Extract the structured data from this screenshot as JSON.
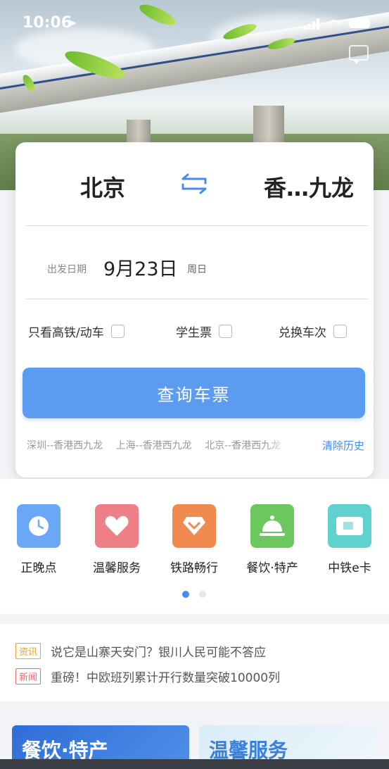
{
  "status_bar": {
    "time": "10:06",
    "location_icon": "location-arrow-icon"
  },
  "route": {
    "from": "北京",
    "to": "香…九龙"
  },
  "date": {
    "label": "出发日期",
    "value": "9月23日",
    "weekday": "周日"
  },
  "options": [
    {
      "label": "只看高铁/动车",
      "checked": false
    },
    {
      "label": "学生票",
      "checked": false
    },
    {
      "label": "兑换车次",
      "checked": false
    }
  ],
  "search_button": "查询车票",
  "history": {
    "items": [
      "深圳--香港西九龙",
      "上海--香港西九龙",
      "北京--香港西九龙"
    ],
    "clear_label": "清除历史"
  },
  "menu": [
    {
      "label": "正晚点",
      "icon": "clock-icon",
      "color": "#6aa8f5"
    },
    {
      "label": "温馨服务",
      "icon": "heart-icon",
      "color": "#ef7f86"
    },
    {
      "label": "铁路畅行",
      "icon": "diamond-icon",
      "color": "#f08a4f"
    },
    {
      "label": "餐饮·特产",
      "icon": "service-bell-icon",
      "color": "#6cc85e"
    },
    {
      "label": "中铁e卡",
      "icon": "card-icon",
      "color": "#5fd2d0"
    }
  ],
  "news": [
    {
      "tag": "资讯",
      "tag_color": "#f0a030",
      "text": "说它是山寨天安门？银川人民可能不答应"
    },
    {
      "tag": "新闻",
      "tag_color": "#ef6b6b",
      "text": "重磅！中欧班列累计开行数量突破10000列"
    }
  ],
  "promos": [
    {
      "label": "餐饮·特产"
    },
    {
      "label": "温馨服务"
    }
  ]
}
